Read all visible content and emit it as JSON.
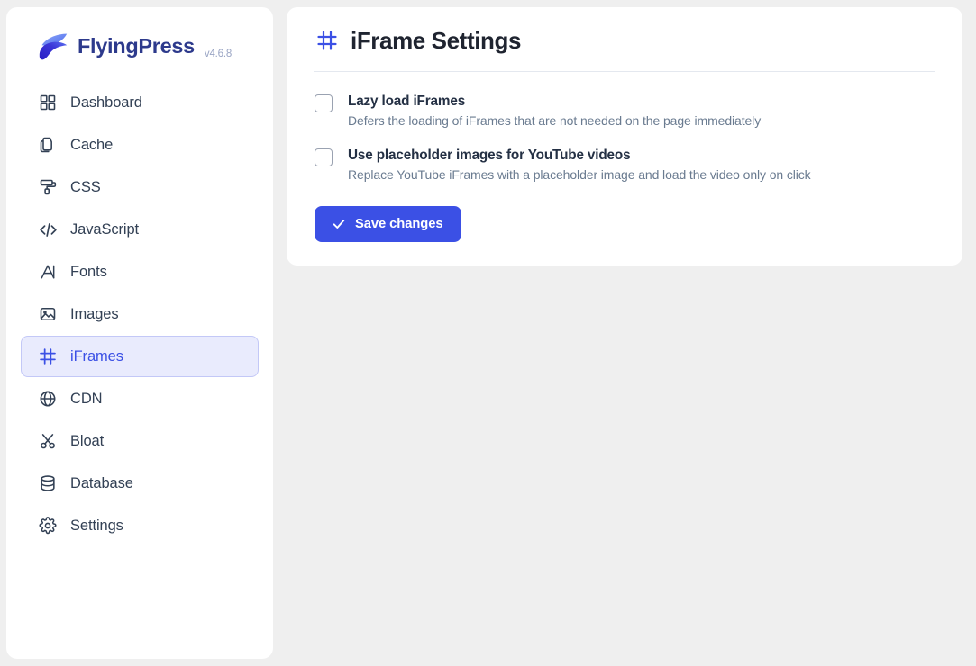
{
  "brand": {
    "name": "FlyingPress",
    "version": "v4.6.8",
    "logo_icon": "flyingpress-wing-logo",
    "logo_colors": {
      "light": "#7b9cf5",
      "mid": "#4f63e8",
      "dark": "#2b1fc4"
    }
  },
  "theme": {
    "page_background": "#efefef",
    "card_background": "#ffffff",
    "accent": "#3b50e5",
    "accent_soft_bg": "#e9ebfd",
    "accent_soft_border": "#c3c8f7",
    "brand_text": "#2d3a8c",
    "nav_text": "#334155",
    "muted_text": "#6a7b90",
    "divider": "#e4e8ef",
    "checkbox_border": "#9aa2b1"
  },
  "sidebar": {
    "items": [
      {
        "label": "Dashboard",
        "icon": "grid-squares-icon",
        "active": false
      },
      {
        "label": "Cache",
        "icon": "copy-pages-icon",
        "active": false
      },
      {
        "label": "CSS",
        "icon": "paint-roller-icon",
        "active": false
      },
      {
        "label": "JavaScript",
        "icon": "code-brackets-icon",
        "active": false
      },
      {
        "label": "Fonts",
        "icon": "letter-a-icon",
        "active": false
      },
      {
        "label": "Images",
        "icon": "picture-icon",
        "active": false
      },
      {
        "label": "iFrames",
        "icon": "frame-hash-icon",
        "active": true
      },
      {
        "label": "CDN",
        "icon": "globe-icon",
        "active": false
      },
      {
        "label": "Bloat",
        "icon": "scissors-icon",
        "active": false
      },
      {
        "label": "Database",
        "icon": "database-icon",
        "active": false
      },
      {
        "label": "Settings",
        "icon": "gear-icon",
        "active": false
      }
    ]
  },
  "main": {
    "title": "iFrame Settings",
    "title_icon": "frame-hash-icon",
    "options": [
      {
        "label": "Lazy load iFrames",
        "description": "Defers the loading of iFrames that are not needed on the page immediately",
        "checked": false
      },
      {
        "label": "Use placeholder images for YouTube videos",
        "description": "Replace YouTube iFrames with a placeholder image and load the video only on click",
        "checked": false
      }
    ],
    "save_label": "Save changes",
    "save_icon": "check-icon"
  }
}
